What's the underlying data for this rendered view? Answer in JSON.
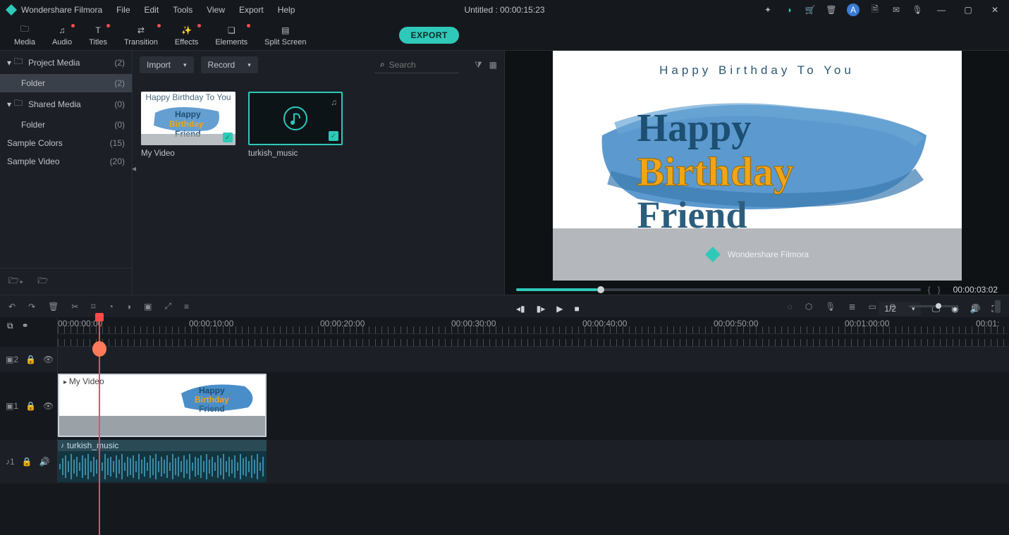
{
  "app": {
    "name": "Wondershare Filmora",
    "title": "Untitled : 00:00:15:23"
  },
  "menu": [
    "File",
    "Edit",
    "Tools",
    "View",
    "Export",
    "Help"
  ],
  "tabs": [
    {
      "label": "Media",
      "dot": false
    },
    {
      "label": "Audio",
      "dot": true
    },
    {
      "label": "Titles",
      "dot": true
    },
    {
      "label": "Transition",
      "dot": true
    },
    {
      "label": "Effects",
      "dot": true
    },
    {
      "label": "Elements",
      "dot": true
    },
    {
      "label": "Split Screen",
      "dot": false
    }
  ],
  "export_label": "EXPORT",
  "sidebar": {
    "items": [
      {
        "label": "Project Media",
        "count": "(2)",
        "indent": false,
        "expandable": true
      },
      {
        "label": "Folder",
        "count": "(2)",
        "indent": true,
        "selected": true
      },
      {
        "label": "Shared Media",
        "count": "(0)",
        "indent": false,
        "expandable": true
      },
      {
        "label": "Folder",
        "count": "(0)",
        "indent": true
      },
      {
        "label": "Sample Colors",
        "count": "(15)",
        "indent": false
      },
      {
        "label": "Sample Video",
        "count": "(20)",
        "indent": false
      }
    ]
  },
  "media": {
    "import_label": "Import",
    "record_label": "Record",
    "search_placeholder": "Search",
    "items": [
      {
        "name": "My Video",
        "type": "video"
      },
      {
        "name": "turkish_music",
        "type": "audio"
      }
    ]
  },
  "preview": {
    "top_text": "Happy Birthday To You",
    "line1": "Happy",
    "line2": "Birthday",
    "line3": "Friend",
    "watermark": "Wondershare Filmora",
    "timecode": "00:00:03:02",
    "ratio": "1/2"
  },
  "ruler": [
    "00:00:00:00",
    "00:00:10:00",
    "00:00:20:00",
    "00:00:30:00",
    "00:00:40:00",
    "00:00:50:00",
    "00:01:00:00",
    "00:01:"
  ],
  "tracks": {
    "fx": "2",
    "video": "1",
    "audio": "1",
    "video_clip": "My Video",
    "audio_clip": "turkish_music"
  }
}
